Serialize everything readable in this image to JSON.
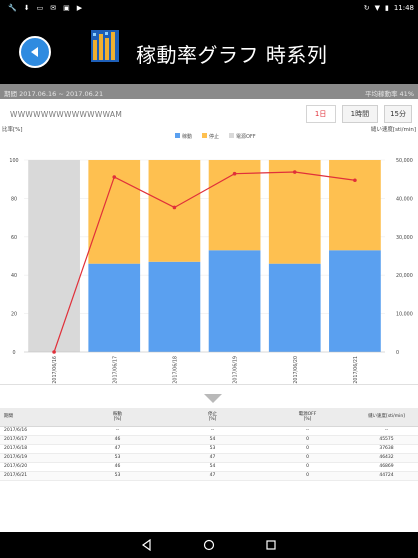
{
  "status_bar": {
    "left_icons": [
      "wrench-icon",
      "download-icon",
      "screen-icon",
      "mail-icon",
      "image-icon",
      "play-store-icon"
    ],
    "right_icons": [
      "sync-icon",
      "wifi-icon",
      "battery-icon"
    ],
    "time": "11:48"
  },
  "app_bar": {
    "title": "稼動率グラフ 時系列"
  },
  "info_bar": {
    "period": "期間 2017.06.16 ~ 2017.06.21",
    "rate": "平均稼動率 41%"
  },
  "machine_name": "WWWWWWWWWWWWWAM",
  "unit_buttons": [
    {
      "label": "1日",
      "active": true
    },
    {
      "label": "1時間",
      "active": false
    },
    {
      "label": "15分",
      "active": false
    }
  ],
  "chart_data": {
    "type": "bar",
    "title": "",
    "ylabel": "比率[%]",
    "y2label": "縫い速度[sti/min]",
    "ylim": [
      0,
      100
    ],
    "y2lim": [
      0,
      50000
    ],
    "yticks": [
      0,
      20,
      40,
      60,
      80,
      100
    ],
    "y2ticks": [
      0,
      10000,
      20000,
      30000,
      40000,
      50000
    ],
    "y2tick_labels": [
      "0",
      "10,000",
      "20,000",
      "30,000",
      "40,000",
      "50,000"
    ],
    "categories": [
      "2017/06/16",
      "2017/06/17",
      "2017/06/18",
      "2017/06/19",
      "2017/06/20",
      "2017/06/21"
    ],
    "legend_position": "top-center",
    "stacked": true,
    "series": [
      {
        "name": "稼動",
        "color": "#5aa0f0",
        "values": [
          0,
          46,
          47,
          53,
          46,
          53
        ]
      },
      {
        "name": "停止",
        "color": "#fec050",
        "values": [
          0,
          54,
          53,
          47,
          54,
          47
        ]
      },
      {
        "name": "電源OFF",
        "color": "#d9d9d9",
        "values": [
          100,
          0,
          0,
          0,
          0,
          0
        ]
      }
    ],
    "line": {
      "name": "縫い速度",
      "color": "#e0303a",
      "axis": "right",
      "values": [
        0,
        45575,
        37638,
        46432,
        46869,
        44724
      ]
    }
  },
  "table": {
    "headers": [
      {
        "label": "期間",
        "unit": ""
      },
      {
        "label": "稼動",
        "unit": "[%]"
      },
      {
        "label": "停止",
        "unit": "[%]"
      },
      {
        "label": "電源OFF",
        "unit": "[%]"
      },
      {
        "label": "縫い速度[sti/min]",
        "unit": ""
      }
    ],
    "rows": [
      [
        "2017/6/16",
        "--",
        "--",
        "--",
        "--"
      ],
      [
        "2017/6/17",
        "46",
        "54",
        "0",
        "45575"
      ],
      [
        "2017/6/18",
        "47",
        "53",
        "0",
        "37638"
      ],
      [
        "2017/6/19",
        "53",
        "47",
        "0",
        "46432"
      ],
      [
        "2017/6/20",
        "46",
        "54",
        "0",
        "46869"
      ],
      [
        "2017/6/21",
        "53",
        "47",
        "0",
        "44724"
      ]
    ]
  }
}
